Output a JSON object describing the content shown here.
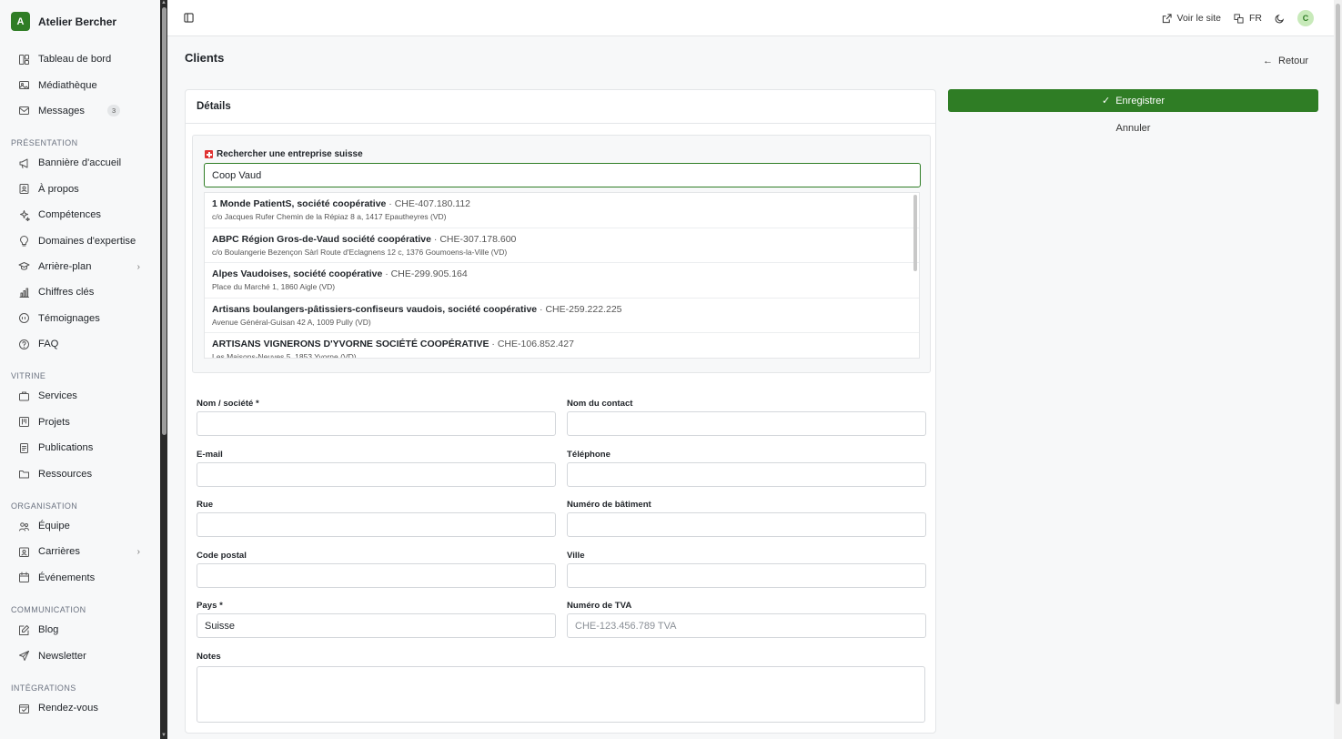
{
  "brand": {
    "initial": "A",
    "name": "Atelier Bercher"
  },
  "sidebar": {
    "top_items": [
      {
        "label": "Tableau de bord",
        "icon": "dashboard-icon"
      },
      {
        "label": "Médiathèque",
        "icon": "image-icon"
      },
      {
        "label": "Messages",
        "icon": "mail-icon",
        "badge": "3"
      }
    ],
    "sections": [
      {
        "title": "PRÉSENTATION",
        "items": [
          {
            "label": "Bannière d'accueil",
            "icon": "megaphone-icon"
          },
          {
            "label": "À propos",
            "icon": "contact-card-icon"
          },
          {
            "label": "Compétences",
            "icon": "sparkles-icon"
          },
          {
            "label": "Domaines d'expertise",
            "icon": "lightbulb-icon"
          },
          {
            "label": "Arrière-plan",
            "icon": "graduation-cap-icon",
            "chevron": true
          },
          {
            "label": "Chiffres clés",
            "icon": "bar-chart-icon"
          },
          {
            "label": "Témoignages",
            "icon": "quote-bubble-icon"
          },
          {
            "label": "FAQ",
            "icon": "help-circle-icon"
          }
        ]
      },
      {
        "title": "VITRINE",
        "items": [
          {
            "label": "Services",
            "icon": "briefcase-icon"
          },
          {
            "label": "Projets",
            "icon": "kanban-icon"
          },
          {
            "label": "Publications",
            "icon": "document-icon"
          },
          {
            "label": "Ressources",
            "icon": "folder-icon"
          }
        ]
      },
      {
        "title": "ORGANISATION",
        "items": [
          {
            "label": "Équipe",
            "icon": "users-icon"
          },
          {
            "label": "Carrières",
            "icon": "id-badge-icon",
            "chevron": true
          },
          {
            "label": "Événements",
            "icon": "calendar-icon"
          }
        ]
      },
      {
        "title": "COMMUNICATION",
        "items": [
          {
            "label": "Blog",
            "icon": "pen-square-icon"
          },
          {
            "label": "Newsletter",
            "icon": "send-icon"
          }
        ]
      },
      {
        "title": "INTÉGRATIONS",
        "items": [
          {
            "label": "Rendez-vous",
            "icon": "calendar-check-icon"
          }
        ]
      }
    ]
  },
  "topbar": {
    "view_site": "Voir le site",
    "lang": "FR",
    "avatar": "C"
  },
  "page": {
    "title": "Clients",
    "back": "Retour"
  },
  "card": {
    "title": "Détails"
  },
  "search": {
    "label": "Rechercher une entreprise suisse",
    "value": "Coop Vaud",
    "results": [
      {
        "name": "1 Monde PatientS, société coopérative",
        "ide": " · CHE-407.180.112",
        "address": "c/o Jacques Rufer Chemin de la Répiaz 8 a, 1417 Epautheyres (VD)"
      },
      {
        "name": "ABPC Région Gros-de-Vaud société coopérative",
        "ide": " · CHE-307.178.600",
        "address": "c/o Boulangerie Bezençon Sàrl Route d'Eclagnens 12 c, 1376 Goumoens-la-Ville (VD)"
      },
      {
        "name": "Alpes Vaudoises, société coopérative",
        "ide": " · CHE-299.905.164",
        "address": "Place du Marché 1, 1860 Aigle (VD)"
      },
      {
        "name": "Artisans boulangers-pâtissiers-confiseurs vaudois, société coopérative",
        "ide": " · CHE-259.222.225",
        "address": "Avenue Général-Guisan 42 A, 1009 Pully (VD)"
      },
      {
        "name": "ARTISANS VIGNERONS D'YVORNE SOCIÉTÉ COOPÉRATIVE",
        "ide": " · CHE-106.852.427",
        "address": "Les Maisons-Neuves 5, 1853 Yvorne (VD)"
      }
    ]
  },
  "form": {
    "name_label": "Nom / société *",
    "contact_label": "Nom du contact",
    "email_label": "E-mail",
    "phone_label": "Téléphone",
    "street_label": "Rue",
    "building_label": "Numéro de bâtiment",
    "zip_label": "Code postal",
    "city_label": "Ville",
    "country_label": "Pays *",
    "country_value": "Suisse",
    "vat_label": "Numéro de TVA",
    "vat_placeholder": "CHE-123.456.789 TVA",
    "notes_label": "Notes"
  },
  "actions": {
    "save": "Enregistrer",
    "cancel": "Annuler"
  },
  "colors": {
    "accent": "#2f7d25",
    "avatar_bg": "#c8eaba"
  }
}
